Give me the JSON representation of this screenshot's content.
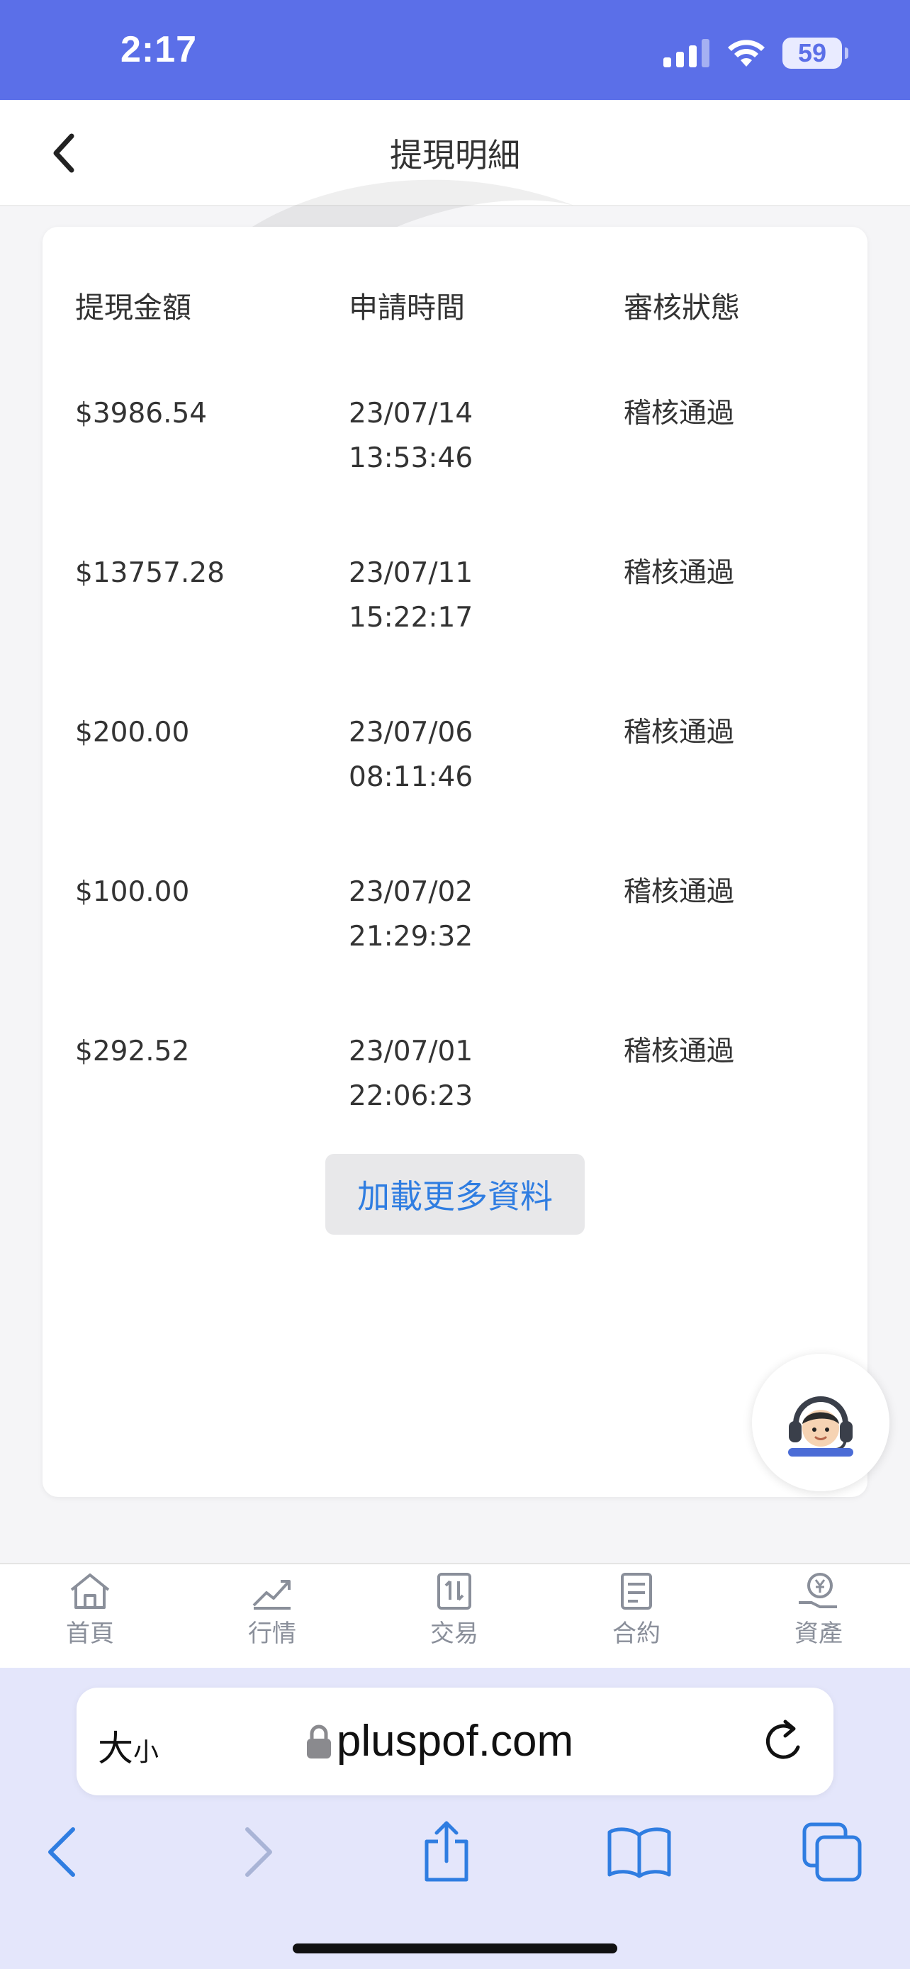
{
  "status_bar": {
    "time": "2:17",
    "battery": "59"
  },
  "header": {
    "title": "提現明細"
  },
  "table": {
    "columns": [
      "提現金額",
      "申請時間",
      "審核狀態"
    ],
    "rows": [
      {
        "amount": "$3986.54",
        "date": "23/07/14",
        "time": "13:53:46",
        "status": "稽核通過"
      },
      {
        "amount": "$13757.28",
        "date": "23/07/11",
        "time": "15:22:17",
        "status": "稽核通過"
      },
      {
        "amount": "$200.00",
        "date": "23/07/06",
        "time": "08:11:46",
        "status": "稽核通過"
      },
      {
        "amount": "$100.00",
        "date": "23/07/02",
        "time": "21:29:32",
        "status": "稽核通過"
      },
      {
        "amount": "$292.52",
        "date": "23/07/01",
        "time": "22:06:23",
        "status": "稽核通過"
      }
    ]
  },
  "load_more_label": "加載更多資料",
  "tabbar": [
    {
      "label": "首頁",
      "icon": "home-icon"
    },
    {
      "label": "行情",
      "icon": "chart-icon"
    },
    {
      "label": "交易",
      "icon": "trade-icon"
    },
    {
      "label": "合約",
      "icon": "contract-icon"
    },
    {
      "label": "資產",
      "icon": "assets-icon"
    }
  ],
  "browser": {
    "text_size_big": "大",
    "text_size_small": "小",
    "url": "pluspof.com"
  },
  "colors": {
    "status_bar": "#5b6fe8",
    "link": "#2f7de1",
    "safari_bar": "#e4e6fb"
  }
}
